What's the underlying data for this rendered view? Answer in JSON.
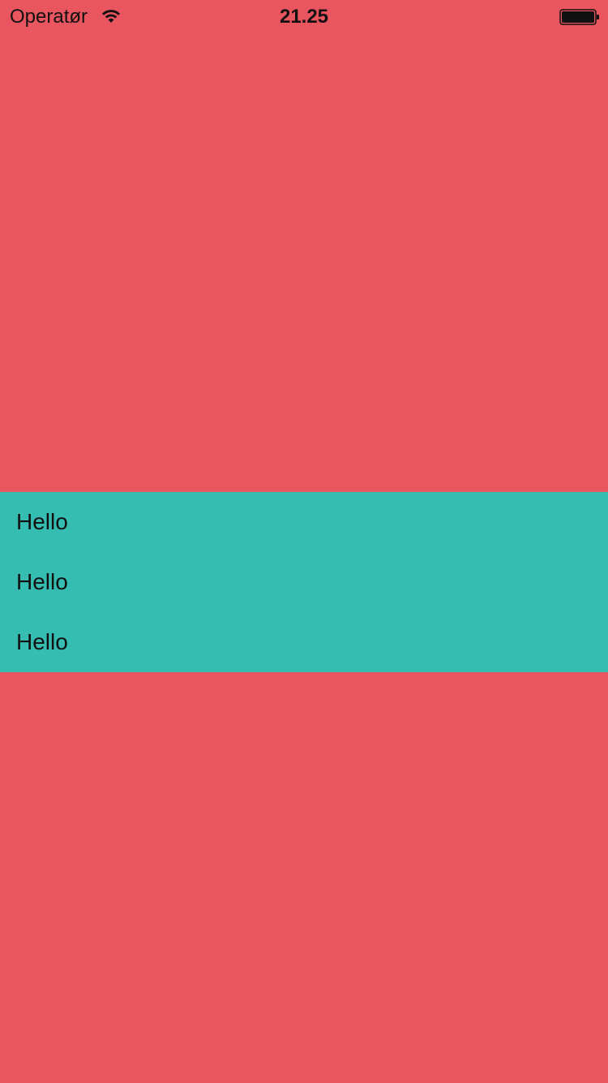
{
  "status_bar": {
    "carrier": "Operatør",
    "time": "21.25",
    "wifi_icon": "wifi-icon",
    "battery_icon": "battery-icon"
  },
  "colors": {
    "background": "#e9565f",
    "list_background": "#35bdb2",
    "text": "#111111"
  },
  "list": {
    "items": [
      {
        "label": "Hello"
      },
      {
        "label": "Hello"
      },
      {
        "label": "Hello"
      }
    ]
  }
}
